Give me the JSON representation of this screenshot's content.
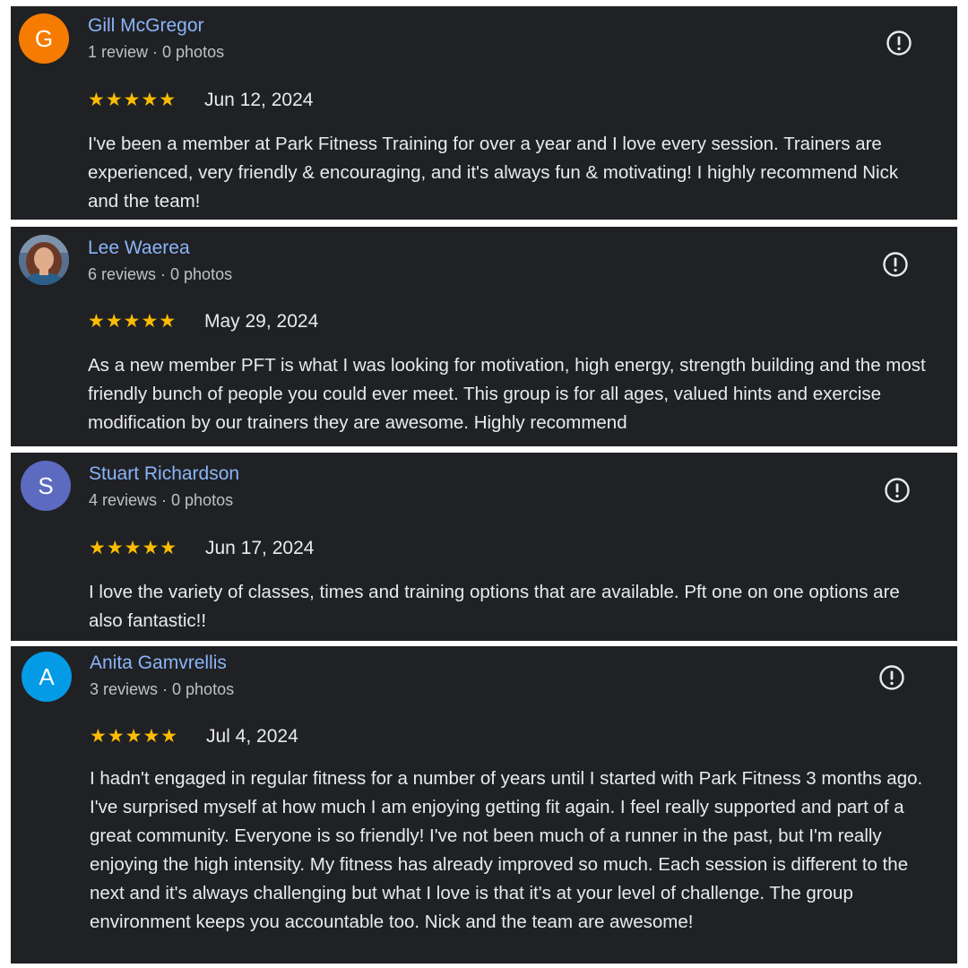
{
  "colors": {
    "card_bg": "#202124",
    "name": "#8ab4f8",
    "star": "#fbbc04"
  },
  "reviews": [
    {
      "avatar_letter": "G",
      "avatar_color": "#f57c00",
      "name": "Gill McGregor",
      "meta": "1 review · 0 photos",
      "stars": "★★★★★",
      "rating": 5,
      "date": "Jun 12, 2024",
      "text": "I've been a member at Park Fitness Training for over a year and I love every session. Trainers are experienced, very friendly & encouraging, and it's always fun & motivating! I highly recommend Nick and the team!"
    },
    {
      "avatar_letter": "",
      "avatar_icon": "profile-photo",
      "name": "Lee Waerea",
      "meta": "6 reviews · 0 photos",
      "stars": "★★★★★",
      "rating": 5,
      "date": "May 29, 2024",
      "text": "As a new member PFT is what I was looking for motivation, high energy, strength building and the most friendly bunch of people you could ever meet. This group is for all ages, valued hints and exercise modification by our trainers they are awesome. Highly recommend"
    },
    {
      "avatar_letter": "S",
      "avatar_color": "#5c6bc0",
      "name": "Stuart Richardson",
      "meta": "4 reviews · 0 photos",
      "stars": "★★★★★",
      "rating": 5,
      "date": "Jun 17, 2024",
      "text": "I love the variety of classes, times and training options that are available. Pft one on one options are also fantastic!!"
    },
    {
      "avatar_letter": "A",
      "avatar_color": "#039be5",
      "name": "Anita Gamvrellis",
      "meta": "3 reviews · 0 photos",
      "stars": "★★★★★",
      "rating": 5,
      "date": "Jul 4, 2024",
      "text": "I hadn't engaged in regular fitness for a number of years until I started with Park Fitness 3 months ago. I've surprised myself at how much I am enjoying getting fit again. I feel really supported and part of a great community. Everyone is so friendly! I've not been much of a runner in the past, but I'm really enjoying the high intensity. My fitness has already improved so much. Each session is different to the next and it's always challenging but what I love is that it's at your level of challenge. The group environment keeps you accountable too. Nick and the team are awesome!"
    }
  ]
}
